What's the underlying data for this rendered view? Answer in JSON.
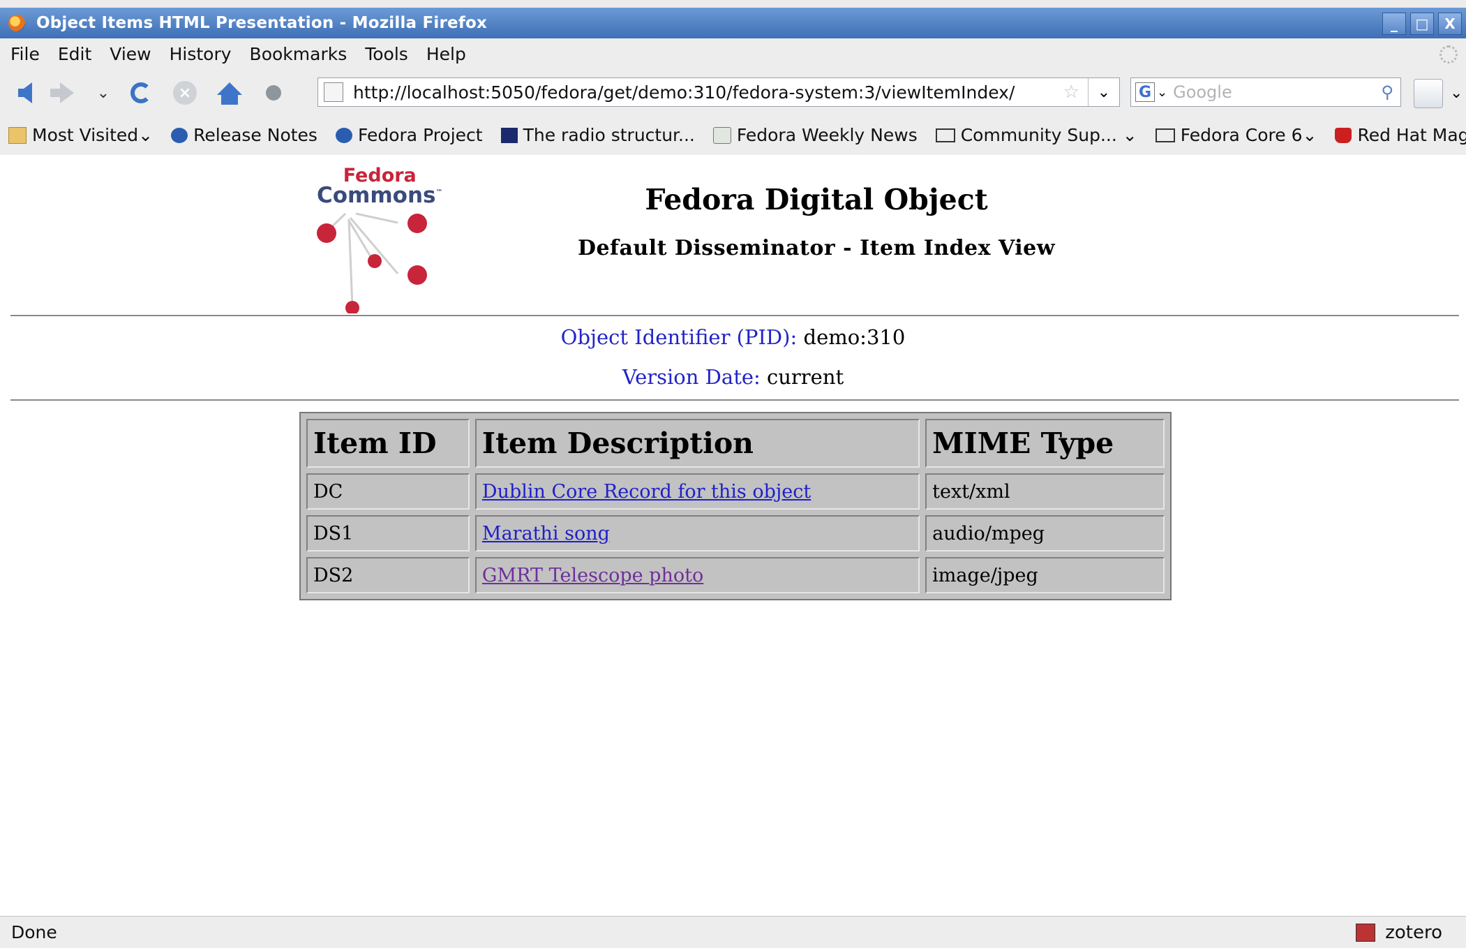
{
  "window": {
    "title": "Object Items HTML Presentation - Mozilla Firefox",
    "controls": {
      "minimize": "_",
      "maximize": "□",
      "close": "X"
    }
  },
  "menu": [
    "File",
    "Edit",
    "View",
    "History",
    "Bookmarks",
    "Tools",
    "Help"
  ],
  "nav": {
    "url": "http://localhost:5050/fedora/get/demo:310/fedora-system:3/viewItemIndex/",
    "search_placeholder": "Google",
    "search_engine": "G"
  },
  "bookmarks": [
    {
      "label": "Most Visited",
      "icon": "folder-icon",
      "dropdown": true
    },
    {
      "label": "Release Notes",
      "icon": "fedora-icon",
      "dropdown": false
    },
    {
      "label": "Fedora Project",
      "icon": "fedora-icon",
      "dropdown": false
    },
    {
      "label": "The radio structur...",
      "icon": "ads-icon",
      "dropdown": false
    },
    {
      "label": "Fedora Weekly News",
      "icon": "rss-icon",
      "dropdown": false
    },
    {
      "label": "Community Sup...",
      "icon": "folder-open-icon",
      "dropdown": true
    },
    {
      "label": "Fedora Core 6",
      "icon": "folder-open-icon",
      "dropdown": true
    },
    {
      "label": "Red Hat Magazine",
      "icon": "redhat-icon",
      "dropdown": false
    }
  ],
  "page": {
    "logo": {
      "line1": "Fedora",
      "line2": "Commons",
      "tm": "™"
    },
    "title": "Fedora Digital Object",
    "subtitle": "Default Disseminator - Item Index View",
    "pid_label": "Object Identifier (PID):",
    "pid_value": "demo:310",
    "version_label": "Version Date:",
    "version_value": "current",
    "table": {
      "headers": [
        "Item ID",
        "Item Description",
        "MIME Type"
      ],
      "rows": [
        {
          "id": "DC",
          "description": "Dublin Core Record for this object",
          "mime": "text/xml",
          "visited": false
        },
        {
          "id": "DS1",
          "description": "Marathi song",
          "mime": "audio/mpeg",
          "visited": false
        },
        {
          "id": "DS2",
          "description": "GMRT Telescope photo",
          "mime": "image/jpeg",
          "visited": true
        }
      ]
    }
  },
  "status": {
    "text": "Done",
    "zotero": "zotero"
  },
  "colors": {
    "link": "#1f1fc9",
    "visited_link": "#6e2f9a",
    "label_blue": "#2323c8",
    "logo_red": "#c8243a"
  }
}
